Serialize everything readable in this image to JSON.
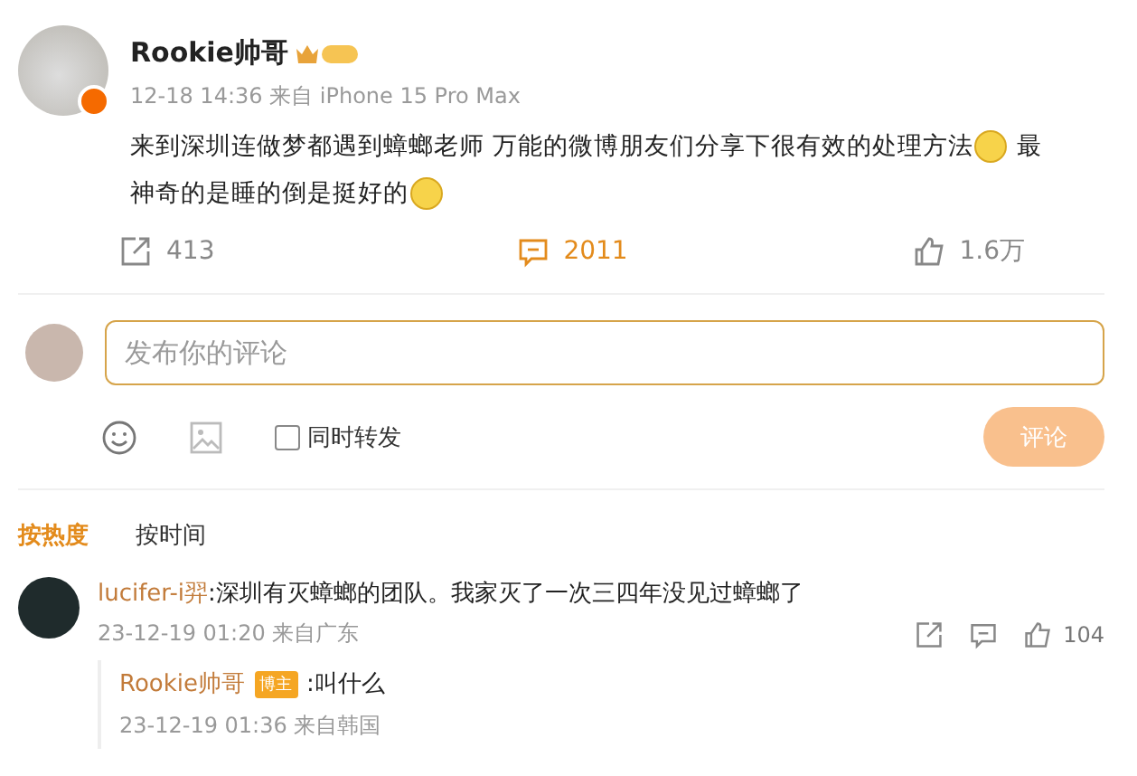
{
  "post": {
    "author": "Rookie帅哥",
    "meta": "12-18 14:36 来自 iPhone 15 Pro Max",
    "verified": true,
    "lines": [
      [
        {
          "kind": "text",
          "text": "来到深圳连做梦都遇到蟑螂老师 万能的微博朋友们分享下很有效的处理方法"
        },
        {
          "kind": "emoji"
        },
        {
          "kind": "text",
          "text": " 最"
        }
      ],
      [
        {
          "kind": "text",
          "text": "神奇的是睡的倒是挺好的"
        },
        {
          "kind": "emoji"
        }
      ]
    ],
    "actions": [
      {
        "kind": "repost",
        "count": "413",
        "selected": false
      },
      {
        "kind": "comment",
        "count": "2011",
        "selected": true
      },
      {
        "kind": "like",
        "count": "1.6万",
        "selected": false
      }
    ]
  },
  "composer": {
    "placeholder": "发布你的评论",
    "repost_label": "同时转发",
    "repost_checked": false,
    "submit": "评论",
    "submit_disabled": true
  },
  "sort_tabs": [
    {
      "label": "按热度",
      "selected": true
    },
    {
      "label": "按时间",
      "selected": false
    }
  ],
  "comments": [
    {
      "author": "lucifer-i羿",
      "text": ":深圳有灭蟑螂的团队。我家灭了一次三四年没见过蟑螂了",
      "meta": "23-12-19 01:20 来自广东",
      "likes": "104",
      "replies": [
        {
          "author": "Rookie帅哥",
          "badge": "博主",
          "text": ":叫什么",
          "meta": "23-12-19 01:36 来自韩国"
        }
      ]
    }
  ]
}
